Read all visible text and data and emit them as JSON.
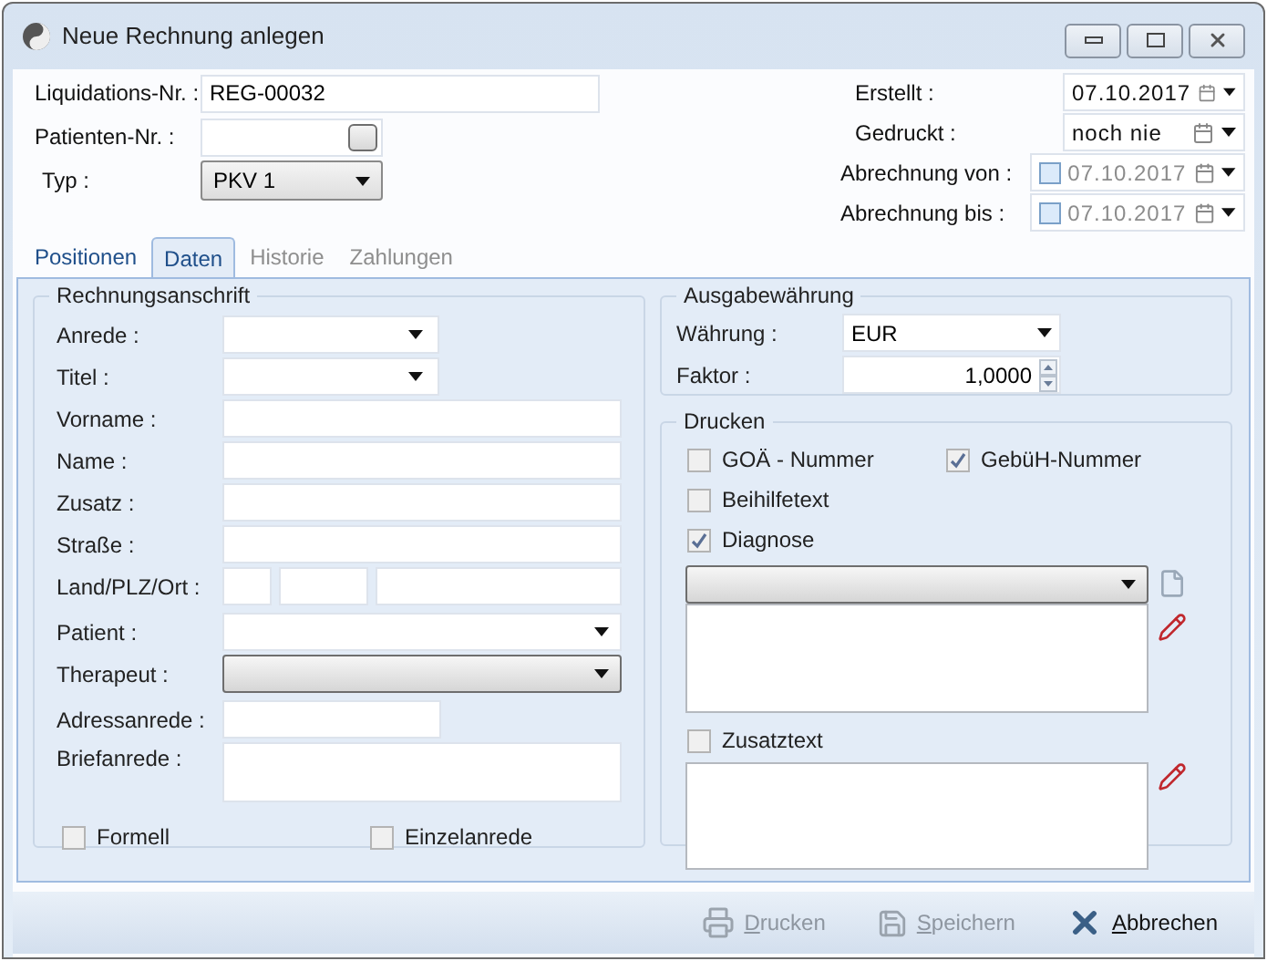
{
  "window": {
    "title": "Neue Rechnung anlegen"
  },
  "header": {
    "left": [
      {
        "label": "Liquidations-Nr. :",
        "value": "REG-00032",
        "kind": "text"
      },
      {
        "label": "Patienten-Nr. :",
        "kind": "lookup"
      },
      {
        "label": "Typ :",
        "value": "PKV 1",
        "kind": "select"
      }
    ],
    "right": [
      {
        "label": "Erstellt :",
        "value": "07.10.2017",
        "kind": "date"
      },
      {
        "label": "Gedruckt :",
        "value": "noch nie",
        "kind": "date"
      },
      {
        "label": "Abrechnung von :",
        "value": "07.10.2017",
        "kind": "check-date",
        "checked": false
      },
      {
        "label": "Abrechnung bis :",
        "value": "07.10.2017",
        "kind": "check-date",
        "checked": false
      }
    ]
  },
  "tabs": [
    {
      "label": "Positionen",
      "selected": false,
      "disabled": false
    },
    {
      "label": "Daten",
      "selected": true,
      "disabled": false
    },
    {
      "label": "Historie",
      "selected": false,
      "disabled": true
    },
    {
      "label": "Zahlungen",
      "selected": false,
      "disabled": true
    }
  ],
  "address": {
    "title": "Rechnungsanschrift",
    "fields": [
      {
        "label": "Anrede :",
        "kind": "short-select"
      },
      {
        "label": "Titel :",
        "kind": "short-select"
      },
      {
        "label": "Vorname :",
        "kind": "text"
      },
      {
        "label": "Name :",
        "kind": "text"
      },
      {
        "label": "Zusatz :",
        "kind": "text"
      },
      {
        "label": "Straße :",
        "kind": "text"
      },
      {
        "label": "Land/PLZ/Ort :",
        "kind": "triple"
      },
      {
        "label": "Patient :",
        "kind": "select"
      },
      {
        "label": "Therapeut :",
        "kind": "button-select"
      },
      {
        "label": "Adressanrede :",
        "kind": "short-text"
      },
      {
        "label": "Briefanrede :",
        "kind": "textarea"
      }
    ],
    "checkboxes": [
      {
        "label": "Formell",
        "checked": false
      },
      {
        "label": "Einzelanrede",
        "checked": false
      }
    ]
  },
  "currency": {
    "title": "Ausgabewährung",
    "fields": [
      {
        "label": "Währung :",
        "value": "EUR",
        "kind": "select"
      },
      {
        "label": "Faktor :",
        "value": "1,0000",
        "kind": "spin"
      }
    ]
  },
  "print": {
    "title": "Drucken",
    "options": [
      [
        {
          "label": "GOÄ - Nummer",
          "checked": false
        },
        {
          "label": "GebüH-Nummer",
          "checked": true
        }
      ],
      [
        {
          "label": "Beihilfetext",
          "checked": false
        }
      ],
      [
        {
          "label": "Diagnose",
          "checked": true
        }
      ]
    ],
    "extra": {
      "label": "Zusatztext",
      "checked": false
    }
  },
  "buttons": [
    {
      "label": "Drucken",
      "kind": "print",
      "disabled": true
    },
    {
      "label": "Speichern",
      "kind": "save",
      "disabled": true
    },
    {
      "label": "Abbrechen",
      "kind": "cancel",
      "disabled": false
    }
  ]
}
